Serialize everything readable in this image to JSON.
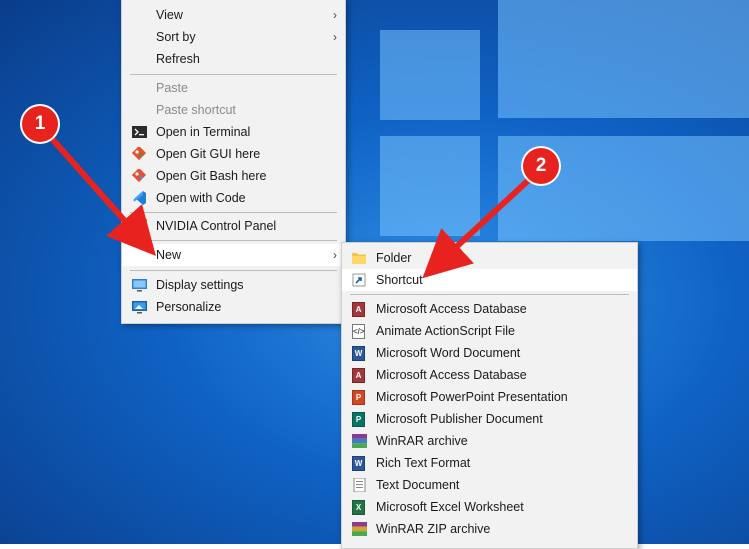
{
  "context_menu": {
    "items": [
      {
        "label": "View",
        "has_submenu": true,
        "disabled": false,
        "icon": ""
      },
      {
        "label": "Sort by",
        "has_submenu": true,
        "disabled": false,
        "icon": ""
      },
      {
        "label": "Refresh",
        "has_submenu": false,
        "disabled": false,
        "icon": ""
      },
      {
        "label": "Paste",
        "has_submenu": false,
        "disabled": true,
        "icon": ""
      },
      {
        "label": "Paste shortcut",
        "has_submenu": false,
        "disabled": true,
        "icon": ""
      },
      {
        "label": "Open in Terminal",
        "has_submenu": false,
        "disabled": false,
        "icon": "terminal-icon"
      },
      {
        "label": "Open Git GUI here",
        "has_submenu": false,
        "disabled": false,
        "icon": "git-icon"
      },
      {
        "label": "Open Git Bash here",
        "has_submenu": false,
        "disabled": false,
        "icon": "git-icon"
      },
      {
        "label": "Open with Code",
        "has_submenu": false,
        "disabled": false,
        "icon": "vscode-icon"
      },
      {
        "label": "NVIDIA Control Panel",
        "has_submenu": false,
        "disabled": false,
        "icon": "nvidia-icon"
      },
      {
        "label": "New",
        "has_submenu": true,
        "disabled": false,
        "icon": ""
      },
      {
        "label": "Display settings",
        "has_submenu": false,
        "disabled": false,
        "icon": "display-icon"
      },
      {
        "label": "Personalize",
        "has_submenu": false,
        "disabled": false,
        "icon": "personalize-icon"
      }
    ]
  },
  "new_submenu": {
    "items": [
      {
        "label": "Folder",
        "icon": "folder-icon"
      },
      {
        "label": "Shortcut",
        "icon": "shortcut-icon"
      },
      {
        "label": "Microsoft Access Database",
        "icon": "access-icon"
      },
      {
        "label": "Animate ActionScript File",
        "icon": "actionscript-icon"
      },
      {
        "label": "Microsoft Word Document",
        "icon": "word-icon"
      },
      {
        "label": "Microsoft Access Database",
        "icon": "access-icon"
      },
      {
        "label": "Microsoft PowerPoint Presentation",
        "icon": "powerpoint-icon"
      },
      {
        "label": "Microsoft Publisher Document",
        "icon": "publisher-icon"
      },
      {
        "label": "WinRAR archive",
        "icon": "winrar-icon"
      },
      {
        "label": "Rich Text Format",
        "icon": "rtf-icon"
      },
      {
        "label": "Text Document",
        "icon": "text-icon"
      },
      {
        "label": "Microsoft Excel Worksheet",
        "icon": "excel-icon"
      },
      {
        "label": "WinRAR ZIP archive",
        "icon": "winrar-zip-icon"
      }
    ]
  },
  "annotations": {
    "badge_1": "1",
    "badge_2": "2",
    "color": "#e8231f"
  },
  "glyphs": {
    "chevron": "›"
  }
}
